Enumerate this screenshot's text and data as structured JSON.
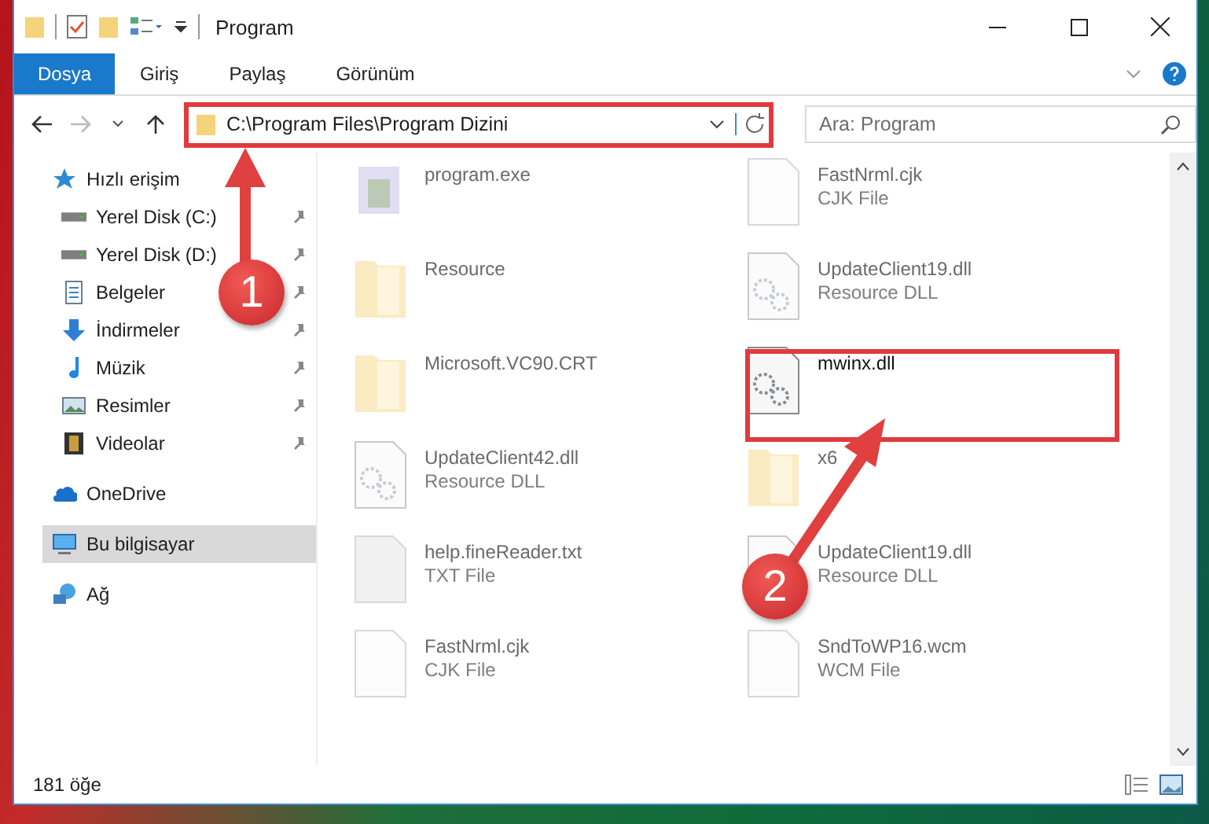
{
  "window": {
    "title": "Program"
  },
  "ribbon_tabs": [
    {
      "label": "Dosya",
      "selected": true
    },
    {
      "label": "Giriş",
      "selected": false
    },
    {
      "label": "Paylaş",
      "selected": false
    },
    {
      "label": "Görünüm",
      "selected": false
    }
  ],
  "address_bar": {
    "path": "C:\\Program Files\\Program Dizini"
  },
  "search": {
    "placeholder": "Ara: Program"
  },
  "sidebar": {
    "items": [
      {
        "label": "Hızlı erişim",
        "kind": "star",
        "selected": false,
        "children": [
          {
            "label": "Yerel Disk (C:)",
            "kind": "drive",
            "pinned": true,
            "selected": false
          },
          {
            "label": "Yerel Disk (D:)",
            "kind": "drive",
            "pinned": true,
            "selected": false
          },
          {
            "label": "Belgeler",
            "kind": "document",
            "pinned": true,
            "selected": false
          },
          {
            "label": "İndirmeler",
            "kind": "download",
            "pinned": true,
            "selected": false
          },
          {
            "label": "Müzik",
            "kind": "music",
            "pinned": true,
            "selected": false
          },
          {
            "label": "Resimler",
            "kind": "picture",
            "pinned": true,
            "selected": false
          },
          {
            "label": "Videolar",
            "kind": "video",
            "pinned": true,
            "selected": false
          }
        ]
      },
      {
        "label": "OneDrive",
        "kind": "cloud",
        "selected": false
      },
      {
        "label": "Bu bilgisayar",
        "kind": "computer",
        "selected": true
      },
      {
        "label": "Ağ",
        "kind": "network",
        "selected": false
      }
    ]
  },
  "files": [
    {
      "name": "program.exe",
      "kind": "exe",
      "faded": true
    },
    {
      "name": "FastNrml.cjk",
      "type": "CJK File",
      "kind": "file",
      "faded": true
    },
    {
      "name": "Resource",
      "kind": "folder",
      "faded": true
    },
    {
      "name": "UpdateClient19.dll",
      "type": "Resource DLL",
      "kind": "dll",
      "faded": true
    },
    {
      "name": "Microsoft.VC90.CRT",
      "kind": "folder",
      "faded": true
    },
    {
      "name": "mwinx.dll",
      "kind": "dll",
      "faded": false
    },
    {
      "name": "UpdateClient42.dll",
      "type": "Resource DLL",
      "kind": "dll",
      "faded": true
    },
    {
      "name": "x6",
      "kind": "folder",
      "faded": true
    },
    {
      "name": "help.fineReader.txt",
      "type": "TXT File",
      "kind": "txt",
      "faded": true
    },
    {
      "name": "UpdateClient19.dll",
      "type": "Resource DLL",
      "kind": "dll",
      "faded": true
    },
    {
      "name": "FastNrml.cjk",
      "type": "CJK File",
      "kind": "file",
      "faded": true
    },
    {
      "name": "SndToWP16.wcm",
      "type": "WCM File",
      "kind": "file",
      "faded": true
    }
  ],
  "status_bar": {
    "count": "181 öğe"
  },
  "annotations": [
    {
      "label": "1"
    },
    {
      "label": "2"
    }
  ]
}
